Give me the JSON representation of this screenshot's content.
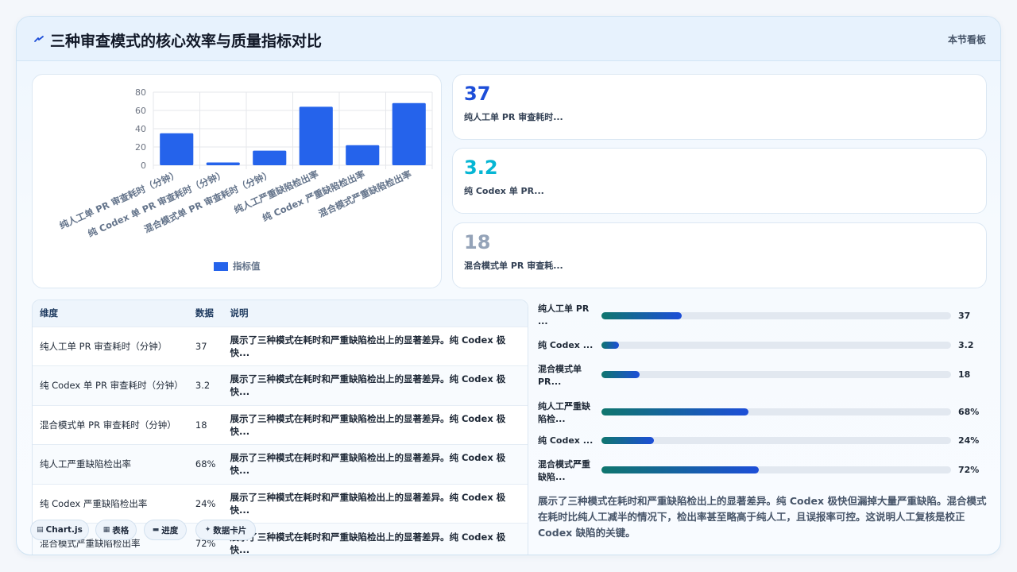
{
  "header": {
    "title": "三种审查模式的核心效率与质量指标对比",
    "side_label": "本节看板"
  },
  "chart_data": {
    "type": "bar",
    "categories": [
      "纯人工单 PR 审查耗时（分钟）",
      "纯 Codex 单 PR 审查耗时（分钟）",
      "混合模式单 PR 审查耗时（分钟）",
      "纯人工严重缺陷检出率",
      "纯 Codex 严重缺陷检出率",
      "混合模式严重缺陷检出率"
    ],
    "series": [
      {
        "name": "指标值",
        "values": [
          35,
          3,
          16,
          64,
          22,
          68
        ]
      }
    ],
    "ylim": [
      0,
      80
    ],
    "yticks": [
      "0",
      "20",
      "40",
      "60",
      "80"
    ],
    "grid": true,
    "legend_position": "bottom",
    "color": "#2563eb"
  },
  "stats": [
    {
      "value": "37",
      "label": "纯人工单 PR 审查耗时...",
      "color": "#1d4ed8"
    },
    {
      "value": "3.2",
      "label": "纯 Codex 单 PR...",
      "color": "#06b6d4"
    },
    {
      "value": "18",
      "label": "混合模式单 PR 审查耗...",
      "color": "#94a3b8"
    }
  ],
  "table": {
    "headers": [
      "维度",
      "数据",
      "说明"
    ],
    "rows": [
      {
        "dim": "纯人工单 PR 审查耗时（分钟）",
        "val": "37",
        "desc": "展示了三种模式在耗时和严重缺陷检出上的显著差异。纯 Codex 极快..."
      },
      {
        "dim": "纯 Codex 单 PR 审查耗时（分钟）",
        "val": "3.2",
        "desc": "展示了三种模式在耗时和严重缺陷检出上的显著差异。纯 Codex 极快..."
      },
      {
        "dim": "混合模式单 PR 审查耗时（分钟）",
        "val": "18",
        "desc": "展示了三种模式在耗时和严重缺陷检出上的显著差异。纯 Codex 极快..."
      },
      {
        "dim": "纯人工严重缺陷检出率",
        "val": "68%",
        "desc": "展示了三种模式在耗时和严重缺陷检出上的显著差异。纯 Codex 极快..."
      },
      {
        "dim": "纯 Codex 严重缺陷检出率",
        "val": "24%",
        "desc": "展示了三种模式在耗时和严重缺陷检出上的显著差异。纯 Codex 极快..."
      },
      {
        "dim": "混合模式严重缺陷检出率",
        "val": "72%",
        "desc": "展示了三种模式在耗时和严重缺陷检出上的显著差异。纯 Codex 极快..."
      }
    ]
  },
  "progress": [
    {
      "label": "纯人工单 PR ...",
      "value": "37",
      "fraction": 0.23
    },
    {
      "label": "纯 Codex ...",
      "value": "3.2",
      "fraction": 0.05
    },
    {
      "label": "混合模式单 PR...",
      "value": "18",
      "fraction": 0.11
    },
    {
      "label": "纯人工严重缺陷检...",
      "value": "68%",
      "fraction": 0.42
    },
    {
      "label": "纯 Codex ...",
      "value": "24%",
      "fraction": 0.15
    },
    {
      "label": "混合模式严重缺陷...",
      "value": "72%",
      "fraction": 0.45
    }
  ],
  "summary": "展示了三种模式在耗时和严重缺陷检出上的显著差异。纯 Codex 极快但漏掉大量严重缺陷。混合模式在耗时比纯人工减半的情况下，检出率甚至略高于纯人工，且误报率可控。这说明人工复核是校正 Codex 缺陷的关键。",
  "chips": [
    {
      "icon": "▤",
      "icon_name": "chart-icon",
      "label": "Chart.js"
    },
    {
      "icon": "▦",
      "icon_name": "table-icon",
      "label": "表格"
    },
    {
      "icon": "▬",
      "icon_name": "progress-icon",
      "label": "进度"
    },
    {
      "icon": "✦",
      "icon_name": "sparkle-icon",
      "label": "数据卡片"
    }
  ]
}
